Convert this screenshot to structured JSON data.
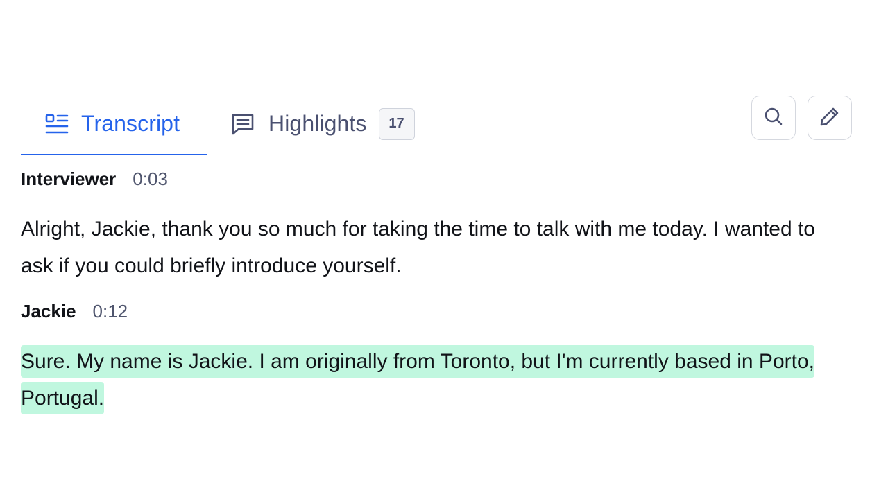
{
  "tabs": {
    "transcript": {
      "label": "Transcript",
      "icon": "transcript-lines-icon",
      "active": true
    },
    "highlights": {
      "label": "Highlights",
      "icon": "message-square-icon",
      "count": "17"
    }
  },
  "toolbar": {
    "search_icon": "search-icon",
    "edit_icon": "pencil-icon"
  },
  "colors": {
    "accent": "#2563eb",
    "highlight": "#c0f7df",
    "muted_text": "#4a5070"
  },
  "transcript": [
    {
      "speaker": "Interviewer",
      "time": "0:03",
      "text": "Alright, Jackie, thank you so much for taking the time to talk with me today. I wanted to ask if you could briefly introduce yourself."
    },
    {
      "speaker": "Jackie",
      "time": "0:12",
      "text": "Sure. My name is Jackie. I am originally from Toronto, but I'm currently based in Porto, Portugal.",
      "highlighted": true
    }
  ]
}
